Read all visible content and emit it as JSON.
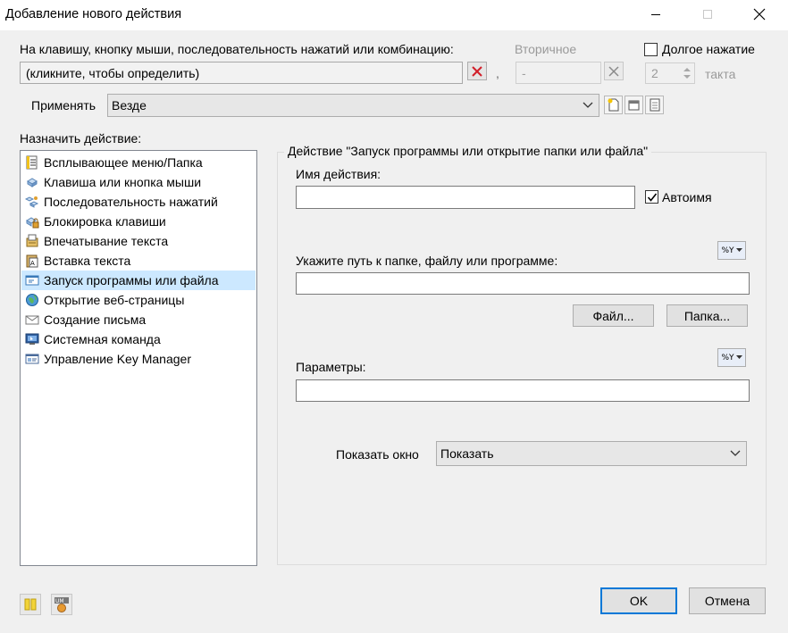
{
  "window": {
    "title": "Добавление нового действия"
  },
  "trigger": {
    "label": "На клавишу, кнопку мыши, последовательность нажатий или комбинацию:",
    "value": "(кликните, чтобы определить)",
    "separator": ",",
    "secondary_label": "Вторичное",
    "secondary_value": "-",
    "long_press_label": "Долгое нажатие",
    "long_press_checked": false,
    "tact_value": "2",
    "tact_label": "такта"
  },
  "apply": {
    "label": "Применять",
    "value": "Везде"
  },
  "actions": {
    "label": "Назначить действие:",
    "items": [
      {
        "label": "Всплывающее меню/Папка",
        "icon": "menu-folder-icon"
      },
      {
        "label": "Клавиша или кнопка мыши",
        "icon": "key-icon"
      },
      {
        "label": "Последовательность нажатий",
        "icon": "key-sequence-icon"
      },
      {
        "label": "Блокировка клавиши",
        "icon": "key-lock-icon"
      },
      {
        "label": "Впечатывание текста",
        "icon": "type-text-icon"
      },
      {
        "label": "Вставка текста",
        "icon": "paste-text-icon"
      },
      {
        "label": "Запуск программы или файла",
        "icon": "run-program-icon"
      },
      {
        "label": "Открытие веб-страницы",
        "icon": "web-page-icon"
      },
      {
        "label": "Создание письма",
        "icon": "email-icon"
      },
      {
        "label": "Системная команда",
        "icon": "system-command-icon"
      },
      {
        "label": "Управление Key Manager",
        "icon": "key-manager-icon"
      }
    ],
    "selected_index": 6
  },
  "details": {
    "group_title": "Действие \"Запуск программы или открытие папки или файла\"",
    "name_label": "Имя действия:",
    "name_value": "",
    "autoname_label": "Автоимя",
    "autoname_checked": true,
    "path_label": "Укажите путь к папке, файлу или программе:",
    "path_value": "",
    "var_button_text": "%Y",
    "file_button": "Файл...",
    "folder_button": "Папка...",
    "params_label": "Параметры:",
    "params_value": "",
    "show_window_label": "Показать окно",
    "show_window_value": "Показать"
  },
  "footer": {
    "ok": "OK",
    "cancel": "Отмена"
  },
  "colors": {
    "accent": "#0078d7",
    "selection": "#cce8ff",
    "clear_x": "#d21f2a"
  }
}
